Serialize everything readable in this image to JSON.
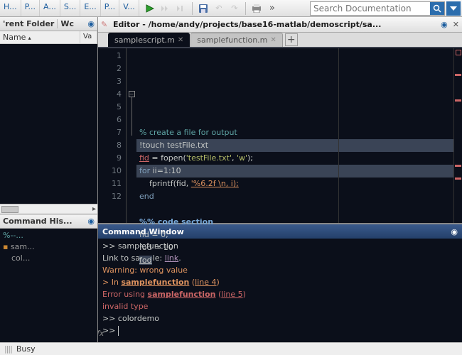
{
  "menu": [
    "H...",
    "P...",
    "A...",
    "S...",
    "E...",
    "P...",
    "V..."
  ],
  "search": {
    "placeholder": "Search Documentation"
  },
  "left": {
    "folder_title": "'rent Folder",
    "wc_tab": "Wc",
    "col_name": "Name",
    "col_val": "Va"
  },
  "history": {
    "title": "Command His...",
    "items": [
      "%--...",
      "sam...",
      "col..."
    ]
  },
  "editor": {
    "title": "Editor - /home/andy/projects/base16-matlab/demoscript/sa...",
    "tabs": [
      {
        "label": "samplescript.m",
        "active": true
      },
      {
        "label": "samplefunction.m",
        "active": false
      }
    ],
    "lines": [
      "1",
      "2",
      "3",
      "4",
      "5",
      "6",
      "7",
      "8",
      "9",
      "10",
      "11",
      "12"
    ],
    "code": {
      "l1_comment": "% create a file for output",
      "l2_shell": "!touch testFile.txt",
      "l3_var": "fid",
      "l3_rest_a": " = fopen(",
      "l3_str1": "'testFile.txt'",
      "l3_mid": ", ",
      "l3_str2": "'w'",
      "l3_end": ");",
      "l4_kw": "for",
      "l4_rest": " ii=1:10",
      "l5_indent": "    fprintf(fid, ",
      "l5_fmt": "'%6.2f \\n, i);",
      "l6_kw": "end",
      "l8_cell": "%% code section",
      "l9": "fid = 0;",
      "l10": "fod = 10",
      "l11": "fod"
    }
  },
  "cmdwin": {
    "title": "Command Window",
    "l1": ">> samplefunction",
    "l2a": "Link to sample: ",
    "l2_link": "link",
    "l2b": ".",
    "l3": "Warning: wrong value",
    "l4a": "> In ",
    "l4b": "samplefunction",
    "l4c": " (",
    "l4d": "line 4",
    "l4e": ")",
    "l5a": "Error using ",
    "l5b": "samplefunction",
    "l5c": " (",
    "l5d": "line 5",
    "l5e": ")",
    "l6": "invalid type",
    "l7": ">> colordemo"
  },
  "status": {
    "busy": "Busy"
  }
}
